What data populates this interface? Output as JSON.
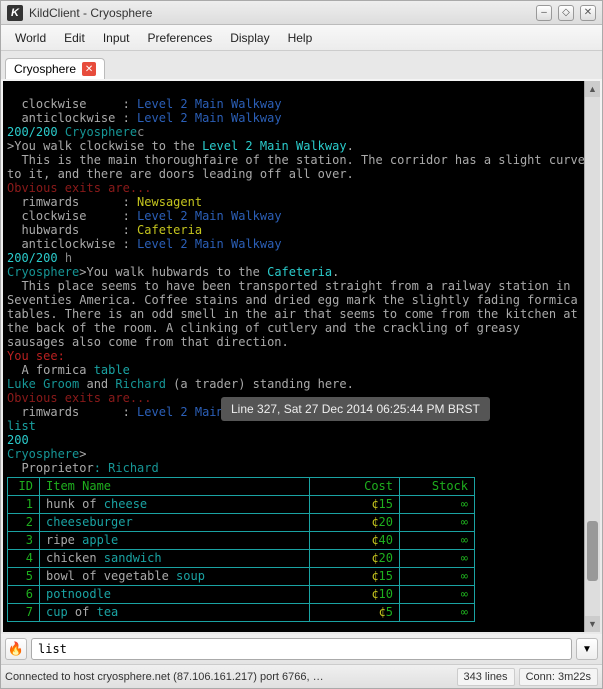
{
  "window": {
    "title": "KildClient - Cryosphere"
  },
  "menu": {
    "items": [
      "World",
      "Edit",
      "Input",
      "Preferences",
      "Display",
      "Help"
    ]
  },
  "tabs": {
    "items": [
      {
        "label": "Cryosphere"
      }
    ]
  },
  "tooltip": "Line 327, Sat 27 Dec 2014 06:25:44 PM BRST",
  "term": {
    "hp1": "200/200",
    "world": "Cryosphere",
    "exit_rimwards": "rimwards",
    "exit_clockwise": "clockwise",
    "exit_hubwards": "hubwards",
    "exit_anticlockwise": "anticlockwise",
    "dest_newsagent": "Newsagent",
    "dest_l2walk": "Level 2 Main Walkway",
    "dest_cafeteria": "Cafeteria",
    "cmd_c": "c",
    "cmd_h": "h",
    "cmd_list": "list",
    "walk_clockwise_pre": ">You walk clockwise to the ",
    "walk_clockwise_dest": "Level 2 Main Walkway",
    "walk_hub_pre": ">You walk hubwards to the ",
    "walk_hub_dest": "Cafeteria",
    "desc_walkway1": "  This is the main thoroughfaire of the station. The corridor has a slight curve",
    "desc_walkway2": "to it, and there are doors leading off all over.",
    "obvious_exits": "Obvious exits are...",
    "desc_caf1": "  This place seems to have been transported straight from a railway station in",
    "desc_caf2": "Seventies America. Coffee stains and dried egg mark the slightly fading formica",
    "desc_caf3": "tables. There is an odd smell in the air that seems to come from the kitchen at",
    "desc_caf4": "the back of the room. A clinking of cutlery and the crackling of greasy",
    "desc_caf5": "sausages also come from that direction.",
    "you_see": "You see:",
    "formica_a": "  A formica ",
    "formica_b": "table",
    "luke": "Luke Groom",
    "and": " and ",
    "richard": "Richard",
    "trader_suffix": " (a trader) standing here.",
    "hp2": "200",
    "proprietor_label": "  Proprietor",
    "proprietor_name": "Richard",
    "prompt": ">"
  },
  "shop": {
    "headers": {
      "id": "ID",
      "name": "Item Name",
      "cost": "Cost",
      "stock": "Stock"
    },
    "rows": [
      {
        "id": "1",
        "name_a": "hunk of ",
        "name_b": "cheese",
        "cost": "¢15",
        "stock": "∞"
      },
      {
        "id": "2",
        "name_a": "",
        "name_b": "cheeseburger",
        "cost": "¢20",
        "stock": "∞"
      },
      {
        "id": "3",
        "name_a": "ripe ",
        "name_b": "apple",
        "cost": "¢40",
        "stock": "∞"
      },
      {
        "id": "4",
        "name_a": "chicken ",
        "name_b": "sandwich",
        "cost": "¢20",
        "stock": "∞"
      },
      {
        "id": "5",
        "name_a": "bowl of vegetable ",
        "name_b": "soup",
        "cost": "¢15",
        "stock": "∞"
      },
      {
        "id": "6",
        "name_a": "",
        "name_b": "potnoodle",
        "cost": "¢10",
        "stock": "∞"
      },
      {
        "id": "7",
        "name_a": "cup",
        "name_b": " of ",
        "name_c": "tea",
        "cost": "¢5",
        "stock": "∞"
      }
    ]
  },
  "input": {
    "value": "list"
  },
  "status": {
    "connection": "Connected to host cryosphere.net (87.106.161.217) port 6766, …",
    "lines": "343 lines",
    "time": "Conn: 3m22s"
  }
}
